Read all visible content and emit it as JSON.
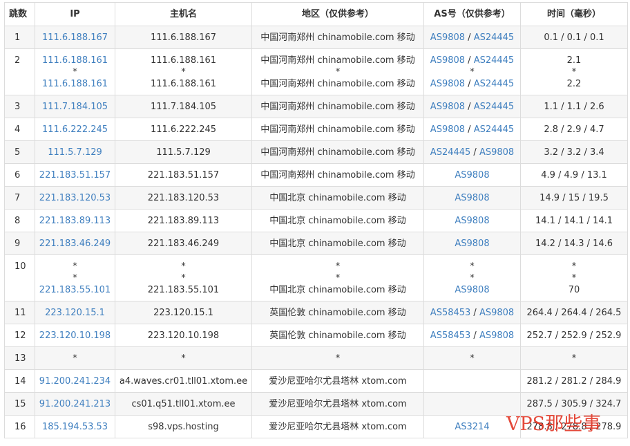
{
  "headers": {
    "hop": "跳数",
    "ip": "IP",
    "host": "主机名",
    "region": "地区（仅供参考）",
    "as": "AS号（仅供参考）",
    "time": "时间（毫秒）"
  },
  "rows": [
    {
      "hop": "1",
      "ip": [
        "111.6.188.167"
      ],
      "host": [
        "111.6.188.167"
      ],
      "region": [
        "中国河南郑州 chinamobile.com 移动"
      ],
      "as": [
        [
          "AS9808",
          "AS24445"
        ]
      ],
      "time": [
        "0.1 / 0.1 / 0.1"
      ]
    },
    {
      "hop": "2",
      "ip": [
        "111.6.188.161",
        "*",
        "111.6.188.161"
      ],
      "host": [
        "111.6.188.161",
        "*",
        "111.6.188.161"
      ],
      "region": [
        "中国河南郑州 chinamobile.com 移动",
        "*",
        "中国河南郑州 chinamobile.com 移动"
      ],
      "as": [
        [
          "AS9808",
          "AS24445"
        ],
        [
          "*"
        ],
        [
          "AS9808",
          "AS24445"
        ]
      ],
      "time": [
        "2.1",
        "*",
        "2.2"
      ]
    },
    {
      "hop": "3",
      "ip": [
        "111.7.184.105"
      ],
      "host": [
        "111.7.184.105"
      ],
      "region": [
        "中国河南郑州 chinamobile.com 移动"
      ],
      "as": [
        [
          "AS9808",
          "AS24445"
        ]
      ],
      "time": [
        "1.1 / 1.1 / 2.6"
      ]
    },
    {
      "hop": "4",
      "ip": [
        "111.6.222.245"
      ],
      "host": [
        "111.6.222.245"
      ],
      "region": [
        "中国河南郑州 chinamobile.com 移动"
      ],
      "as": [
        [
          "AS9808",
          "AS24445"
        ]
      ],
      "time": [
        "2.8 / 2.9 / 4.7"
      ]
    },
    {
      "hop": "5",
      "ip": [
        "111.5.7.129"
      ],
      "host": [
        "111.5.7.129"
      ],
      "region": [
        "中国河南郑州 chinamobile.com 移动"
      ],
      "as": [
        [
          "AS24445",
          "AS9808"
        ]
      ],
      "time": [
        "3.2 / 3.2 / 3.4"
      ]
    },
    {
      "hop": "6",
      "ip": [
        "221.183.51.157"
      ],
      "host": [
        "221.183.51.157"
      ],
      "region": [
        "中国河南郑州 chinamobile.com 移动"
      ],
      "as": [
        [
          "AS9808"
        ]
      ],
      "time": [
        "4.9 / 4.9 / 13.1"
      ]
    },
    {
      "hop": "7",
      "ip": [
        "221.183.120.53"
      ],
      "host": [
        "221.183.120.53"
      ],
      "region": [
        "中国北京 chinamobile.com 移动"
      ],
      "as": [
        [
          "AS9808"
        ]
      ],
      "time": [
        "14.9 / 15 / 19.5"
      ]
    },
    {
      "hop": "8",
      "ip": [
        "221.183.89.113"
      ],
      "host": [
        "221.183.89.113"
      ],
      "region": [
        "中国北京 chinamobile.com 移动"
      ],
      "as": [
        [
          "AS9808"
        ]
      ],
      "time": [
        "14.1 / 14.1 / 14.1"
      ]
    },
    {
      "hop": "9",
      "ip": [
        "221.183.46.249"
      ],
      "host": [
        "221.183.46.249"
      ],
      "region": [
        "中国北京 chinamobile.com 移动"
      ],
      "as": [
        [
          "AS9808"
        ]
      ],
      "time": [
        "14.2 / 14.3 / 14.6"
      ]
    },
    {
      "hop": "10",
      "ip": [
        "*",
        "*",
        "221.183.55.101"
      ],
      "host": [
        "*",
        "*",
        "221.183.55.101"
      ],
      "region": [
        "*",
        "*",
        "中国北京 chinamobile.com 移动"
      ],
      "as": [
        [
          "*"
        ],
        [
          "*"
        ],
        [
          "AS9808"
        ]
      ],
      "time": [
        "*",
        "*",
        "70"
      ]
    },
    {
      "hop": "11",
      "ip": [
        "223.120.15.1"
      ],
      "host": [
        "223.120.15.1"
      ],
      "region": [
        "英国伦敦 chinamobile.com 移动"
      ],
      "as": [
        [
          "AS58453",
          "AS9808"
        ]
      ],
      "time": [
        "264.4 / 264.4 / 264.5"
      ]
    },
    {
      "hop": "12",
      "ip": [
        "223.120.10.198"
      ],
      "host": [
        "223.120.10.198"
      ],
      "region": [
        "英国伦敦 chinamobile.com 移动"
      ],
      "as": [
        [
          "AS58453",
          "AS9808"
        ]
      ],
      "time": [
        "252.7 / 252.9 / 252.9"
      ]
    },
    {
      "hop": "13",
      "ip": [
        "*"
      ],
      "host": [
        "*"
      ],
      "region": [
        "*"
      ],
      "as": [
        [
          "*"
        ]
      ],
      "time": [
        "*"
      ]
    },
    {
      "hop": "14",
      "ip": [
        "91.200.241.234"
      ],
      "host": [
        "a4.waves.cr01.tll01.xtom.ee"
      ],
      "region": [
        "爱沙尼亚哈尔尤县塔林 xtom.com"
      ],
      "as": [],
      "time": [
        "281.2 / 281.2 / 284.9"
      ]
    },
    {
      "hop": "15",
      "ip": [
        "91.200.241.213"
      ],
      "host": [
        "cs01.q51.tll01.xtom.ee"
      ],
      "region": [
        "爱沙尼亚哈尔尤县塔林 xtom.com"
      ],
      "as": [],
      "time": [
        "287.5 / 305.9 / 324.7"
      ]
    },
    {
      "hop": "16",
      "ip": [
        "185.194.53.53"
      ],
      "host": [
        "s98.vps.hosting"
      ],
      "region": [
        "爱沙尼亚哈尔尤县塔林 xtom.com"
      ],
      "as": [
        [
          "AS3214"
        ]
      ],
      "time": [
        "278.8 / 278.8 / 278.9"
      ]
    }
  ],
  "watermark": "VPS那些事",
  "colors": {
    "link": "#3f7fbf",
    "stripe": "#f6f6f6",
    "border": "#dcdcdc",
    "watermark": "#e23a2a"
  }
}
